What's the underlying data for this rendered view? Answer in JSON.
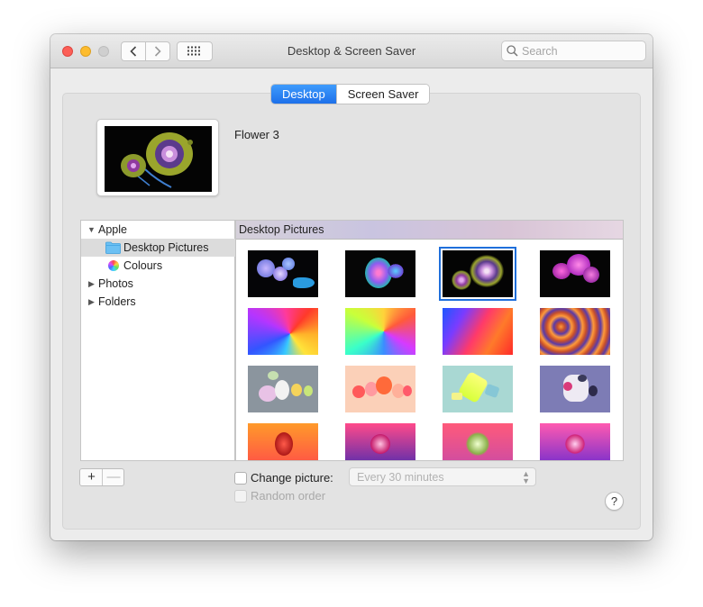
{
  "window": {
    "title": "Desktop & Screen Saver"
  },
  "toolbar": {
    "search_placeholder": "Search"
  },
  "tabs": [
    {
      "label": "Desktop",
      "active": true
    },
    {
      "label": "Screen Saver",
      "active": false
    }
  ],
  "current_picture": {
    "name": "Flower 3"
  },
  "sidebar": {
    "items": [
      {
        "label": "Apple",
        "expanded": true
      },
      {
        "label": "Desktop Pictures",
        "selected": true,
        "icon": "folder-icon"
      },
      {
        "label": "Colours",
        "icon": "colour-wheel-icon"
      },
      {
        "label": "Photos",
        "expanded": false
      },
      {
        "label": "Folders",
        "expanded": false
      }
    ]
  },
  "gallery": {
    "header": "Desktop Pictures",
    "selected_index": 2,
    "thumbnails": [
      "flower-blue-purple",
      "flower-neon",
      "flower-yellow-selected",
      "flower-magenta",
      "paint-swirl-rainbow",
      "paint-swirl-multicolor",
      "paint-red-blue",
      "paint-waves-orange",
      "shapes-grey",
      "shapes-peach",
      "shapes-crystal-teal",
      "shapes-lavender",
      "flower-red-orange",
      "flower-purple-red",
      "flower-green-pink",
      "flower-pink-purple"
    ]
  },
  "controls": {
    "add_symbol": "+",
    "remove_symbol": "—",
    "change_picture_label": "Change picture:",
    "change_picture_checked": false,
    "interval_value": "Every 30 minutes",
    "random_order_label": "Random order",
    "random_order_checked": false,
    "help_symbol": "?"
  }
}
